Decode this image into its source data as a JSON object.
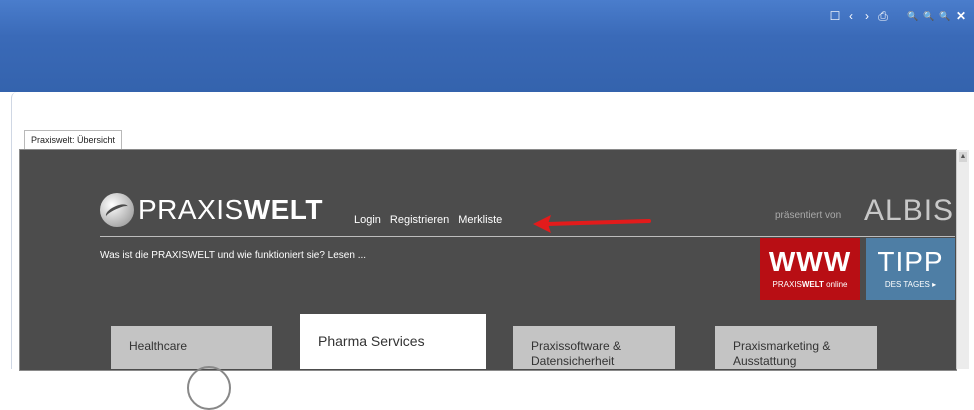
{
  "toolbar": {
    "icons": [
      "window-icon",
      "back-icon",
      "forward-icon",
      "print-icon",
      "zoom-out-icon",
      "zoom-reset-icon",
      "zoom-in-icon",
      "close-icon"
    ],
    "glyphs": [
      "☐",
      "‹",
      "›",
      "⎙",
      "🔍",
      "🔍",
      "🔍",
      "✕"
    ]
  },
  "tab": {
    "label": "Praxiswelt: Übersicht"
  },
  "logo": {
    "brand_light": "PRAXIS",
    "brand_bold": "WELT"
  },
  "nav": {
    "login": "Login",
    "register": "Registrieren",
    "watchlist": "Merkliste"
  },
  "sponsor": {
    "presented_by": "präsentiert von",
    "name": "ALBIS"
  },
  "intro": "Was ist die PRAXISWELT und wie funktioniert sie? Lesen ...",
  "www_badge": {
    "big": "WWW",
    "small_light": "PRAXIS",
    "small_bold": "WELT",
    "small_suffix": " online"
  },
  "tipp_badge": {
    "big": "TIPP",
    "small": "DES TAGES ▸"
  },
  "tiles": [
    {
      "label": "Healthcare"
    },
    {
      "label": "Pharma Services"
    },
    {
      "label": "Praxissoftware & Datensicherheit"
    },
    {
      "label": "Praxismarketing & Ausstattung"
    }
  ],
  "colors": {
    "topbar": "#3a6ab8",
    "panel": "#4c4c4c",
    "www": "#b80e14",
    "tipp": "#4e7ea5",
    "arrow": "#e31b1b"
  }
}
